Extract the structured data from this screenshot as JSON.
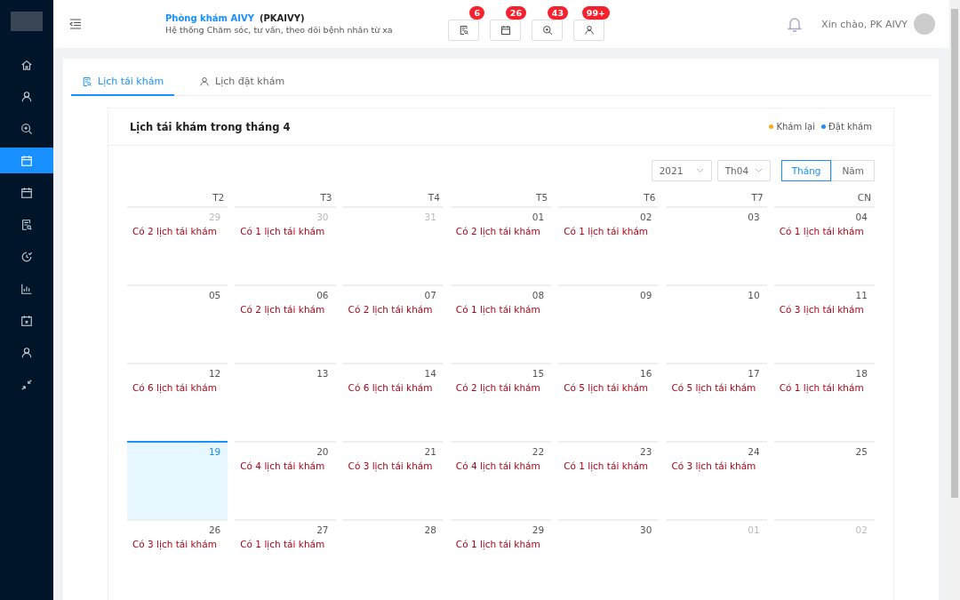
{
  "sidebar": {
    "items": [
      {
        "selected": false
      },
      {
        "selected": false
      },
      {
        "selected": false
      },
      {
        "selected": true
      },
      {
        "selected": false
      },
      {
        "selected": false
      },
      {
        "selected": false
      },
      {
        "selected": false
      },
      {
        "selected": false
      },
      {
        "selected": false
      },
      {
        "selected": false
      }
    ]
  },
  "header": {
    "clinic_name": "Phòng khám AIVY",
    "clinic_code": "(PKAIVY)",
    "subtitle": "Hệ thống Chăm sóc, tư vấn, theo dõi bệnh nhân từ xa",
    "shortcuts": [
      {
        "badge": "6"
      },
      {
        "badge": "26"
      },
      {
        "badge": "43"
      },
      {
        "badge": "99+"
      }
    ],
    "greeting": "Xin chào, PK AIVY"
  },
  "tabs": [
    {
      "label": "Lịch tái khám",
      "selected": true
    },
    {
      "label": "Lịch đặt khám",
      "selected": false
    }
  ],
  "calendar": {
    "title": "Lịch tái khám trong tháng 4",
    "legend": [
      {
        "label": "Khám lại",
        "color": "#faad14"
      },
      {
        "label": "Đặt khám",
        "color": "#1890ff"
      }
    ],
    "year": "2021",
    "month": "Th04",
    "modes": [
      {
        "label": "Tháng",
        "selected": true
      },
      {
        "label": "Năm",
        "selected": false
      }
    ],
    "weekdays": [
      "T2",
      "T3",
      "T4",
      "T5",
      "T6",
      "T7",
      "CN"
    ],
    "weeks": [
      [
        {
          "date": "29",
          "muted": true,
          "selected": false,
          "note": "Có 2 lịch tái khám"
        },
        {
          "date": "30",
          "muted": true,
          "selected": false,
          "note": "Có 1 lịch tái khám"
        },
        {
          "date": "31",
          "muted": true,
          "selected": false
        },
        {
          "date": "01",
          "muted": false,
          "selected": false,
          "note": "Có 2 lịch tái khám"
        },
        {
          "date": "02",
          "muted": false,
          "selected": false,
          "note": "Có 1 lịch tái khám"
        },
        {
          "date": "03",
          "muted": false,
          "selected": false
        },
        {
          "date": "04",
          "muted": false,
          "selected": false,
          "note": "Có 1 lịch tái khám"
        }
      ],
      [
        {
          "date": "05",
          "muted": false,
          "selected": false
        },
        {
          "date": "06",
          "muted": false,
          "selected": false,
          "note": "Có 2 lịch tái khám"
        },
        {
          "date": "07",
          "muted": false,
          "selected": false,
          "note": "Có 2 lịch tái khám"
        },
        {
          "date": "08",
          "muted": false,
          "selected": false,
          "note": "Có 1 lịch tái khám"
        },
        {
          "date": "09",
          "muted": false,
          "selected": false
        },
        {
          "date": "10",
          "muted": false,
          "selected": false
        },
        {
          "date": "11",
          "muted": false,
          "selected": false,
          "note": "Có 3 lịch tái khám"
        }
      ],
      [
        {
          "date": "12",
          "muted": false,
          "selected": false,
          "note": "Có 6 lịch tái khám"
        },
        {
          "date": "13",
          "muted": false,
          "selected": false
        },
        {
          "date": "14",
          "muted": false,
          "selected": false,
          "note": "Có 6 lịch tái khám"
        },
        {
          "date": "15",
          "muted": false,
          "selected": false,
          "note": "Có 2 lịch tái khám"
        },
        {
          "date": "16",
          "muted": false,
          "selected": false,
          "note": "Có 5 lịch tái khám"
        },
        {
          "date": "17",
          "muted": false,
          "selected": false,
          "note": "Có 5 lịch tái khám"
        },
        {
          "date": "18",
          "muted": false,
          "selected": false,
          "note": "Có 1 lịch tái khám"
        }
      ],
      [
        {
          "date": "19",
          "muted": false,
          "selected": true
        },
        {
          "date": "20",
          "muted": false,
          "selected": false,
          "note": "Có 4 lịch tái khám"
        },
        {
          "date": "21",
          "muted": false,
          "selected": false,
          "note": "Có 3 lịch tái khám"
        },
        {
          "date": "22",
          "muted": false,
          "selected": false,
          "note": "Có 4 lịch tái khám"
        },
        {
          "date": "23",
          "muted": false,
          "selected": false,
          "note": "Có 1 lịch tái khám"
        },
        {
          "date": "24",
          "muted": false,
          "selected": false,
          "note": "Có 3 lịch tái khám"
        },
        {
          "date": "25",
          "muted": false,
          "selected": false
        }
      ],
      [
        {
          "date": "26",
          "muted": false,
          "selected": false,
          "note": "Có 3 lịch tái khám"
        },
        {
          "date": "27",
          "muted": false,
          "selected": false,
          "note": "Có 1 lịch tái khám"
        },
        {
          "date": "28",
          "muted": false,
          "selected": false
        },
        {
          "date": "29",
          "muted": false,
          "selected": false,
          "note": "Có 1 lịch tái khám"
        },
        {
          "date": "30",
          "muted": false,
          "selected": false
        },
        {
          "date": "01",
          "muted": true,
          "selected": false
        },
        {
          "date": "02",
          "muted": true,
          "selected": false
        }
      ]
    ]
  }
}
